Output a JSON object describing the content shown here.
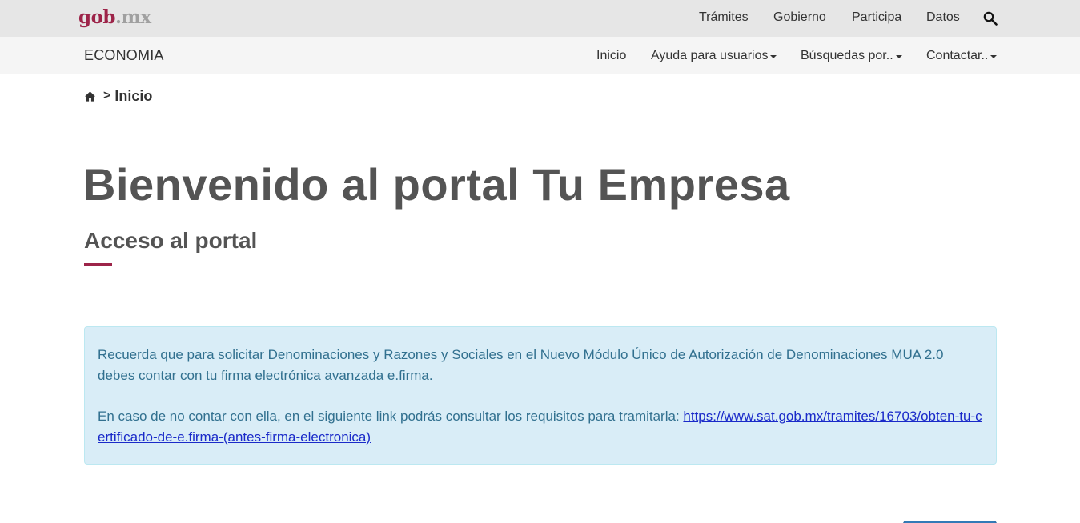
{
  "topbar": {
    "logo_main": "gob",
    "logo_suffix": ".mx",
    "nav": [
      "Trámites",
      "Gobierno",
      "Participa",
      "Datos"
    ],
    "search_icon": "search-icon"
  },
  "subbar": {
    "brand": "ECONOMIA",
    "nav": [
      "Inicio",
      "Ayuda para usuarios",
      "Búsquedas por..",
      "Contactar.."
    ]
  },
  "breadcrumb": {
    "home_icon": "home-icon",
    "separator": ">",
    "current": "Inicio"
  },
  "main": {
    "title": "Bienvenido al portal Tu Empresa",
    "section_title": "Acceso al portal"
  },
  "alert": {
    "paragraph1": "Recuerda que para solicitar Denominaciones y Razones y Sociales en el Nuevo Módulo Único de Autorización de Denominaciones MUA 2.0 debes contar con tu firma electrónica avanzada e.firma.",
    "paragraph2_text": "En caso de no contar con ella, en el siguiente link podrás consultar los requisitos para tramitarla: ",
    "link_text": "https://www.sat.gob.mx/tramites/16703/obten-tu-certificado-de-e.firma-(antes-firma-electronica)"
  },
  "colors": {
    "brand": "#9d2449",
    "alert_bg": "#d9edf7",
    "alert_text": "#31708f",
    "link": "#1a2ac9"
  }
}
